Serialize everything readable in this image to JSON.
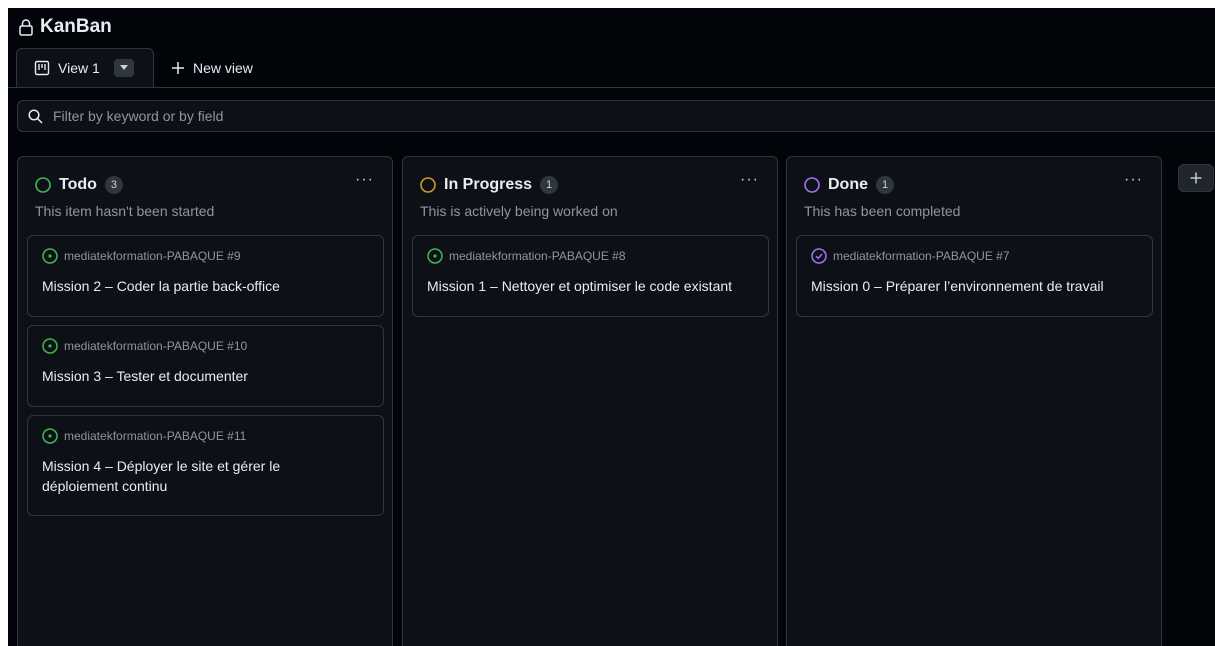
{
  "project": {
    "title": "KanBan"
  },
  "tabs": {
    "active_label": "View 1",
    "new_view_label": "New view"
  },
  "filter": {
    "placeholder": "Filter by keyword or by field"
  },
  "colors": {
    "todo": "#3fb950",
    "in_progress": "#d29922",
    "done": "#a371f7",
    "done_icon": "#a371f7",
    "open_issue": "#3fb950"
  },
  "columns": [
    {
      "name": "Todo",
      "count": "3",
      "description": "This item hasn't been started",
      "cards": [
        {
          "ref": "mediatekformation-PABAQUE #9",
          "title": "Mission 2 – Coder la partie back-office",
          "icon": "issue-open-icon"
        },
        {
          "ref": "mediatekformation-PABAQUE #10",
          "title": "Mission 3 – Tester et documenter",
          "icon": "issue-open-icon"
        },
        {
          "ref": "mediatekformation-PABAQUE #11",
          "title": "Mission 4 – Déployer le site et gérer le déploiement continu",
          "icon": "issue-open-icon"
        }
      ]
    },
    {
      "name": "In Progress",
      "count": "1",
      "description": "This is actively being worked on",
      "cards": [
        {
          "ref": "mediatekformation-PABAQUE #8",
          "title": "Mission 1 – Nettoyer et optimiser le code existant",
          "icon": "issue-open-icon"
        }
      ]
    },
    {
      "name": "Done",
      "count": "1",
      "description": "This has been completed",
      "cards": [
        {
          "ref": "mediatekformation-PABAQUE #7",
          "title": "Mission 0 – Préparer l’environnement de travail",
          "icon": "issue-closed-icon"
        }
      ]
    }
  ]
}
